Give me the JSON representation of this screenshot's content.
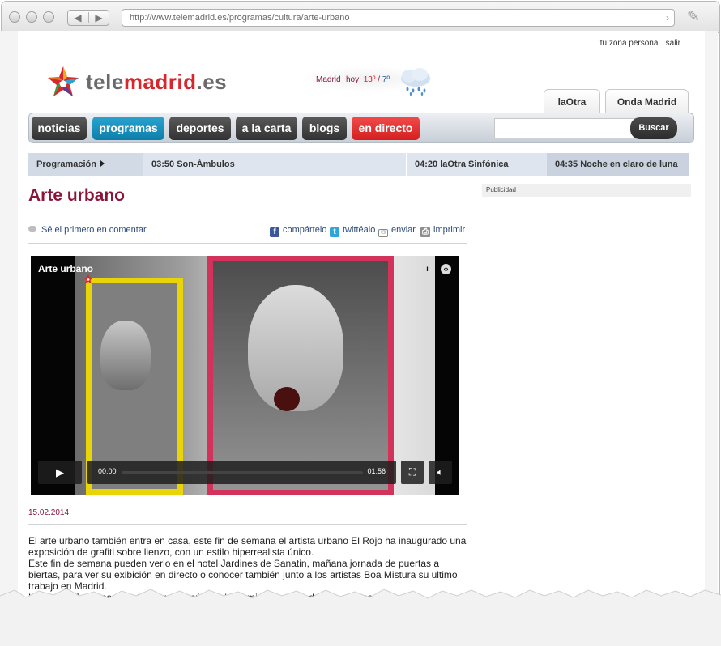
{
  "browser": {
    "url": "http://www.telemadrid.es/programas/cultura/arte-urbano"
  },
  "top_links": {
    "personal": "tu zona personal",
    "logout": "salir"
  },
  "logo": {
    "part1": "tele",
    "part2": "madrid",
    "part3": ".es"
  },
  "weather": {
    "city": "Madrid",
    "label": "hoy:",
    "high": "13º",
    "low": "7º",
    "icon": "rain-cloud-icon"
  },
  "side_tabs": [
    "laOtra",
    "Onda Madrid"
  ],
  "nav": {
    "items": [
      "noticias",
      "programas",
      "deportes",
      "a la carta",
      "blogs",
      "en directo"
    ],
    "search_button": "Buscar",
    "search_value": ""
  },
  "schedule": {
    "label": "Programación",
    "items": [
      "03:50 Son-Ámbulos",
      "04:20 laOtra Sinfónica",
      "04:35 Noche en claro de luna"
    ]
  },
  "article": {
    "title": "Arte urbano",
    "comment": "Sé el primero en comentar",
    "share": {
      "facebook": "compártelo",
      "twitter": "twittéalo",
      "email": "enviar",
      "print": "imprimir"
    },
    "date": "15.02.2014",
    "paragraphs": [
      "El arte urbano también entra en casa, este fin de semana el artista urbano El Rojo ha inaugurado una exposición de grafiti sobre lienzo, con un estilo hiperrealista único.",
      "Este fin de semana pueden verlo en el hotel Jardines de Sanatin, mañana jornada de puertas a biertas, para ver su exibición en directo o conocer también junto a los artistas Boa Mistura su ultimo trabajo en Madrid.",
      "Las suites Jardines Sabatini abren al público /el domingo la obra de tres artistas."
    ]
  },
  "ad": {
    "label": "Publicidad"
  },
  "video": {
    "title": "Arte urbano",
    "time_current": "00:00",
    "time_total": "01:56",
    "progress": 0
  },
  "colors": {
    "brand_red": "#d9262c",
    "title_maroon": "#8a1538",
    "nav_blue": "#0d7ea9",
    "link_blue": "#2b4b7a"
  }
}
